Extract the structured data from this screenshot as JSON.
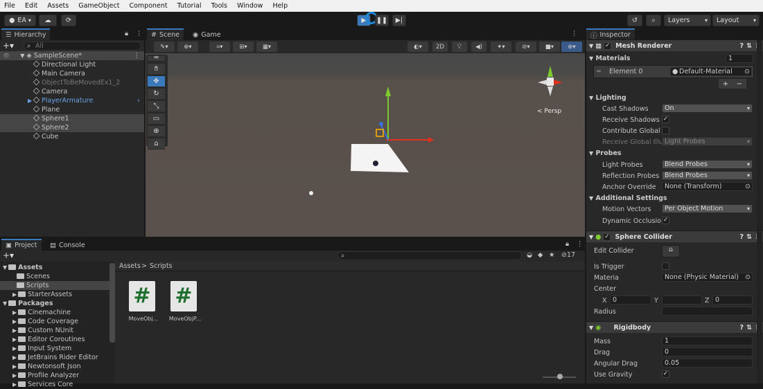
{
  "menu": [
    "File",
    "Edit",
    "Assets",
    "GameObject",
    "Component",
    "Tutorial",
    "Tools",
    "Window",
    "Help"
  ],
  "toolbar": {
    "account": "EA",
    "layers": "Layers",
    "layout": "Layout"
  },
  "hierarchy": {
    "title": "Hierarchy",
    "search_placeholder": "All",
    "scene": "SampleScene*",
    "items": [
      "Directional Light",
      "Main Camera",
      "ObjectToBeMovedEx1_2",
      "Camera",
      "PlayerArmature",
      "Plane",
      "Sphere1",
      "Sphere2",
      "Cube"
    ]
  },
  "scene_tabs": {
    "scene": "Scene",
    "game": "Game"
  },
  "scene_view": {
    "mode_2d": "2D",
    "persp": "< Persp"
  },
  "project": {
    "tab_project": "Project",
    "tab_console": "Console",
    "breadcrumb_root": "Assets",
    "breadcrumb_child": "Scripts",
    "hidden_count": "17",
    "tree": [
      {
        "label": "Assets",
        "bold": true
      },
      {
        "label": "Scenes"
      },
      {
        "label": "Scripts"
      },
      {
        "label": "StarterAssets"
      },
      {
        "label": "Packages",
        "bold": true
      },
      {
        "label": "Cinemachine"
      },
      {
        "label": "Code Coverage"
      },
      {
        "label": "Custom NUnit"
      },
      {
        "label": "Editor Coroutines"
      },
      {
        "label": "Input System"
      },
      {
        "label": "JetBrains Rider Editor"
      },
      {
        "label": "Newtonsoft Json"
      },
      {
        "label": "Profile Analyzer"
      },
      {
        "label": "Services Core"
      }
    ],
    "files": [
      {
        "name": "MoveObj..."
      },
      {
        "name": "MoveObjP..."
      }
    ]
  },
  "inspector": {
    "title": "Inspector",
    "mesh_renderer": "Mesh Renderer",
    "materials": "Materials",
    "materials_count": "1",
    "element0": "Element 0",
    "element0_value": "Default-Material",
    "lighting": "Lighting",
    "cast_shadows": "Cast Shadows",
    "cast_shadows_value": "On",
    "receive_shadows": "Receive Shadows",
    "contribute_gi": "Contribute Global I",
    "receive_gi": "Receive Global Illu",
    "receive_gi_value": "Light Probes",
    "probes": "Probes",
    "light_probes": "Light Probes",
    "light_probes_value": "Blend Probes",
    "reflection_probes": "Reflection Probes",
    "reflection_probes_value": "Blend Probes",
    "anchor_override": "Anchor Override",
    "anchor_override_value": "None (Transform)",
    "additional": "Additional Settings",
    "motion_vectors": "Motion Vectors",
    "motion_vectors_value": "Per Object Motion",
    "dynamic_occlusion": "Dynamic Occlusio",
    "sphere_collider": "Sphere Collider",
    "edit_collider": "Edit Collider",
    "is_trigger": "Is Trigger",
    "material": "Materia",
    "material_value": "None (Physic Material)",
    "center": "Center",
    "cx": "X",
    "cx_val": "0",
    "cy": "Y",
    "cy_val": "",
    "cz": "Z",
    "cz_val": "0",
    "radius": "Radius",
    "rigidbody": "Rigidbody",
    "mass": "Mass",
    "mass_val": "1",
    "drag": "Drag",
    "drag_val": "0",
    "angular_drag": "Angular Drag",
    "angular_drag_val": "0.05",
    "use_gravity": "Use Gravity"
  },
  "colors": {
    "accent": "#3a79bb",
    "selection": "#454545",
    "x_axis": "#e0301e",
    "y_axis": "#7ccc30",
    "z_axis": "#3773e0"
  }
}
